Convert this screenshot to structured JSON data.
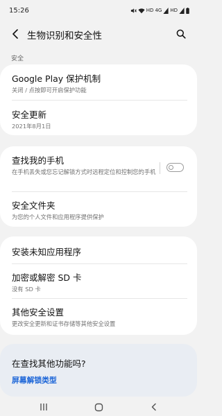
{
  "status_bar": {
    "time": "15:26",
    "icons": [
      "mute-icon",
      "wifi-icon",
      "hd-badge-icon",
      "4g-signal-icon",
      "signal-icon",
      "battery-icon"
    ],
    "hd_label_1": "HD",
    "lte_label": "4G",
    "hd_label_2": "HD"
  },
  "header": {
    "title": "生物识别和安全性",
    "back_icon": "back-arrow-icon",
    "search_icon": "search-icon"
  },
  "section": {
    "label": "安全"
  },
  "items": [
    {
      "title": "Google Play 保护机制",
      "subtitle": "关闭 / 点按即可开启保护功能"
    },
    {
      "title": "安全更新",
      "subtitle": "2021年8月1日"
    },
    {
      "title": "查找我的手机",
      "subtitle": "在手机丢失或您忘记解锁方式时远程定位和控制您的手机",
      "toggle_on": false
    },
    {
      "title": "安全文件夹",
      "subtitle": "为您的个人文件和应用程序提供保护"
    },
    {
      "title": "安装未知应用程序",
      "subtitle": ""
    },
    {
      "title": "加密或解密 SD 卡",
      "subtitle": "没有 SD 卡"
    },
    {
      "title": "其他安全设置",
      "subtitle": "更改安全更新和证书存储等其他安全设置"
    }
  ],
  "more": {
    "title": "在查找其他功能吗?",
    "link": "屏幕解锁类型"
  },
  "colors": {
    "background": "#f2f2f2",
    "card": "#ffffff",
    "suggestion_card": "#e9edf3",
    "link": "#1d66d8",
    "subtitle": "#727272"
  },
  "nav_bar": {
    "icons": [
      "recents-icon",
      "home-icon",
      "back-icon"
    ]
  }
}
